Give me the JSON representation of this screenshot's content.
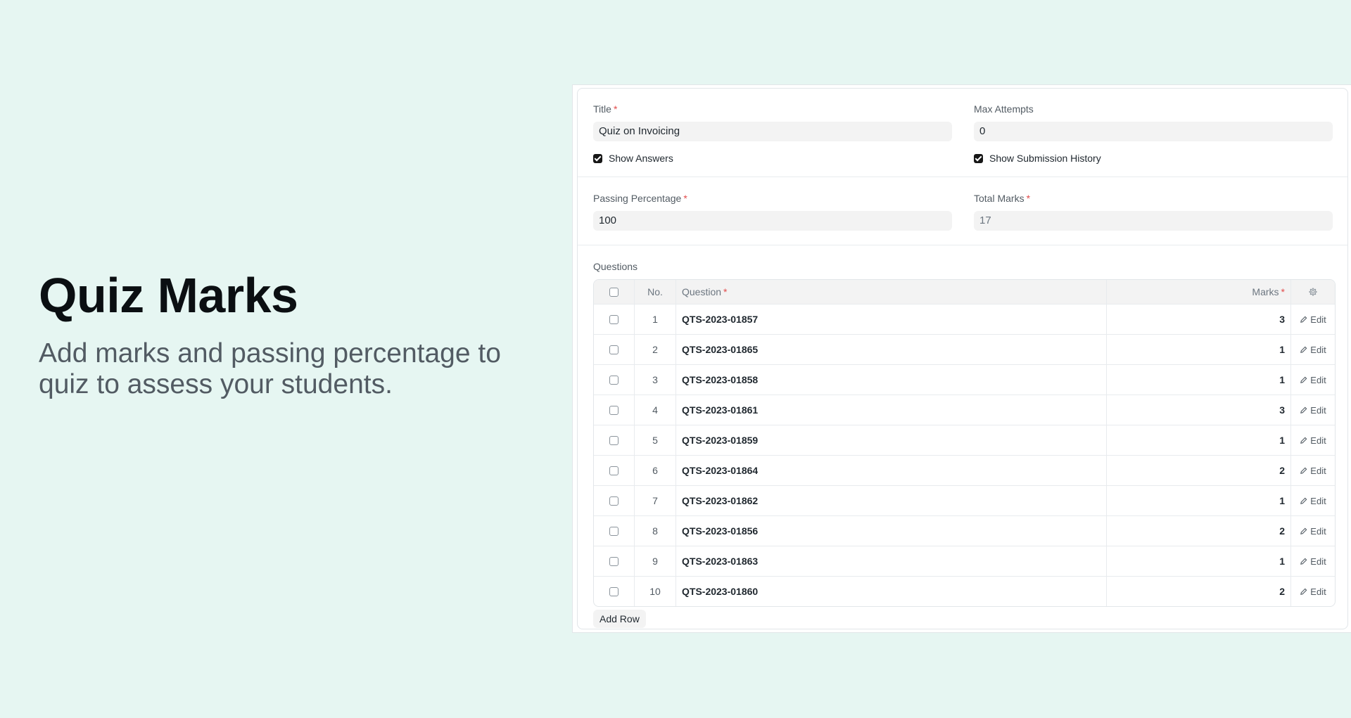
{
  "hero": {
    "title": "Quiz Marks",
    "subtitle": "Add marks and passing percentage to quiz to assess your students."
  },
  "form": {
    "title_label": "Title",
    "title_value": "Quiz on Invoicing",
    "max_attempts_label": "Max Attempts",
    "max_attempts_value": "0",
    "show_answers_label": "Show Answers",
    "show_answers_checked": true,
    "show_submission_history_label": "Show Submission History",
    "show_submission_history_checked": true,
    "passing_percentage_label": "Passing Percentage",
    "passing_percentage_value": "100",
    "total_marks_label": "Total Marks",
    "total_marks_value": "17",
    "required_marker": "*"
  },
  "questions": {
    "label": "Questions",
    "columns": {
      "no": "No.",
      "question": "Question",
      "marks": "Marks"
    },
    "edit_label": "Edit",
    "add_row_label": "Add Row",
    "rows": [
      {
        "no": "1",
        "question": "QTS-2023-01857",
        "marks": "3"
      },
      {
        "no": "2",
        "question": "QTS-2023-01865",
        "marks": "1"
      },
      {
        "no": "3",
        "question": "QTS-2023-01858",
        "marks": "1"
      },
      {
        "no": "4",
        "question": "QTS-2023-01861",
        "marks": "3"
      },
      {
        "no": "5",
        "question": "QTS-2023-01859",
        "marks": "1"
      },
      {
        "no": "6",
        "question": "QTS-2023-01864",
        "marks": "2"
      },
      {
        "no": "7",
        "question": "QTS-2023-01862",
        "marks": "1"
      },
      {
        "no": "8",
        "question": "QTS-2023-01856",
        "marks": "2"
      },
      {
        "no": "9",
        "question": "QTS-2023-01863",
        "marks": "1"
      },
      {
        "no": "10",
        "question": "QTS-2023-01860",
        "marks": "2"
      }
    ]
  },
  "icons": {
    "header_settings": "gear-icon",
    "row_edit": "pencil-icon"
  }
}
